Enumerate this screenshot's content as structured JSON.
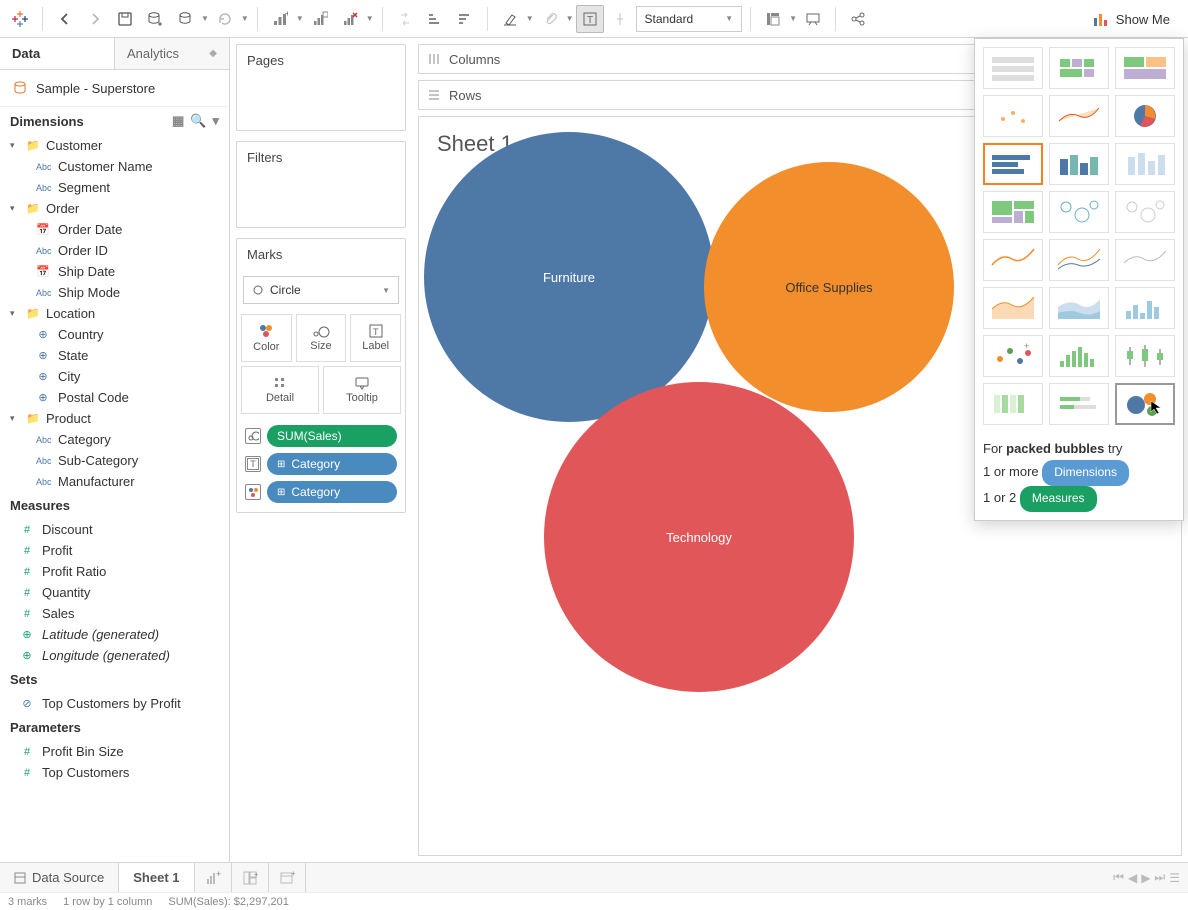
{
  "toolbar": {
    "fit_select": "Standard",
    "showme_label": "Show Me"
  },
  "data_pane": {
    "tab_data": "Data",
    "tab_analytics": "Analytics",
    "datasource": "Sample - Superstore",
    "dimensions_header": "Dimensions",
    "groups": [
      {
        "label": "Customer",
        "items": [
          {
            "icon": "Abc",
            "label": "Customer Name"
          },
          {
            "icon": "Abc",
            "label": "Segment"
          }
        ]
      },
      {
        "label": "Order",
        "items": [
          {
            "icon": "date",
            "label": "Order Date"
          },
          {
            "icon": "Abc",
            "label": "Order ID"
          },
          {
            "icon": "date",
            "label": "Ship Date"
          },
          {
            "icon": "Abc",
            "label": "Ship Mode"
          }
        ]
      },
      {
        "label": "Location",
        "items": [
          {
            "icon": "geo",
            "label": "Country"
          },
          {
            "icon": "geo",
            "label": "State"
          },
          {
            "icon": "geo",
            "label": "City"
          },
          {
            "icon": "geo",
            "label": "Postal Code"
          }
        ]
      },
      {
        "label": "Product",
        "items": [
          {
            "icon": "Abc",
            "label": "Category"
          },
          {
            "icon": "Abc",
            "label": "Sub-Category"
          },
          {
            "icon": "Abc",
            "label": "Manufacturer"
          }
        ]
      }
    ],
    "measures_header": "Measures",
    "measures": [
      {
        "label": "Discount"
      },
      {
        "label": "Profit"
      },
      {
        "label": "Profit Ratio"
      },
      {
        "label": "Quantity"
      },
      {
        "label": "Sales"
      },
      {
        "label": "Latitude (generated)",
        "italic": true
      },
      {
        "label": "Longitude (generated)",
        "italic": true
      }
    ],
    "sets_header": "Sets",
    "sets": [
      {
        "label": "Top Customers by Profit"
      }
    ],
    "parameters_header": "Parameters",
    "parameters": [
      {
        "label": "Profit Bin Size"
      },
      {
        "label": "Top Customers"
      }
    ]
  },
  "shelves": {
    "pages": "Pages",
    "filters": "Filters",
    "marks": "Marks",
    "mark_type": "Circle",
    "cells": {
      "color": "Color",
      "size": "Size",
      "label": "Label",
      "detail": "Detail",
      "tooltip": "Tooltip"
    },
    "pills": [
      {
        "kind": "size",
        "color": "green",
        "label": "SUM(Sales)"
      },
      {
        "kind": "label",
        "color": "blue",
        "label": "Category"
      },
      {
        "kind": "color",
        "color": "blue",
        "label": "Category"
      }
    ]
  },
  "colrow": {
    "columns": "Columns",
    "rows": "Rows"
  },
  "sheet": {
    "title": "Sheet 1"
  },
  "chart_data": {
    "type": "packed-bubbles",
    "series": [
      {
        "name": "Furniture",
        "color": "#4e79a7",
        "rel_size": 1.0
      },
      {
        "name": "Office Supplies",
        "color": "#f28e2b",
        "rel_size": 0.73
      },
      {
        "name": "Technology",
        "color": "#e15759",
        "rel_size": 1.13
      }
    ]
  },
  "showme": {
    "hint_prefix": "For ",
    "hint_bold": "packed bubbles",
    "hint_suffix": " try",
    "line1_prefix": "1 or more ",
    "line1_pill": "Dimensions",
    "line2_prefix": "1 or 2 ",
    "line2_pill": "Measures"
  },
  "bottom": {
    "datasource": "Data Source",
    "sheet": "Sheet 1"
  },
  "status": {
    "marks": "3 marks",
    "rowcol": "1 row by 1 column",
    "sum": "SUM(Sales): $2,297,201"
  }
}
